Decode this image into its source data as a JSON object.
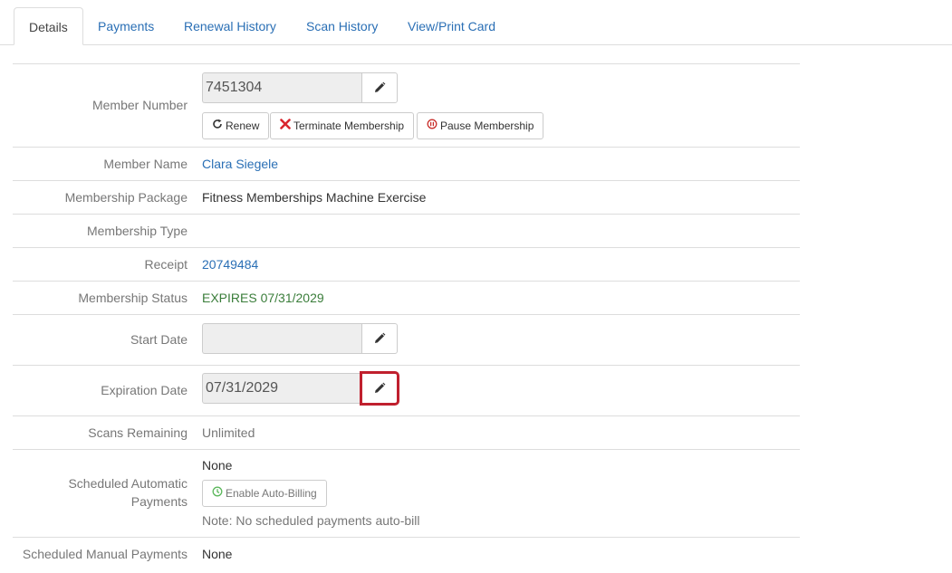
{
  "tabs": [
    {
      "label": "Details",
      "active": true
    },
    {
      "label": "Payments",
      "active": false
    },
    {
      "label": "Renewal History",
      "active": false
    },
    {
      "label": "Scan History",
      "active": false
    },
    {
      "label": "View/Print Card",
      "active": false
    }
  ],
  "member_number": {
    "label": "Member Number",
    "value": "7451304",
    "renew_label": "Renew",
    "terminate_label": "Terminate Membership",
    "pause_label": "Pause Membership"
  },
  "member_name": {
    "label": "Member Name",
    "value": "Clara Siegele"
  },
  "membership_package": {
    "label": "Membership Package",
    "value": "Fitness Memberships Machine Exercise"
  },
  "membership_type": {
    "label": "Membership Type",
    "value": ""
  },
  "receipt": {
    "label": "Receipt",
    "value": "20749484"
  },
  "membership_status": {
    "label": "Membership Status",
    "value": "EXPIRES 07/31/2029"
  },
  "start_date": {
    "label": "Start Date",
    "value": ""
  },
  "expiration_date": {
    "label": "Expiration Date",
    "value": "07/31/2029"
  },
  "scans_remaining": {
    "label": "Scans Remaining",
    "value": "Unlimited"
  },
  "scheduled_automatic_payments": {
    "label_line1": "Scheduled Automatic",
    "label_line2": "Payments",
    "value": "None",
    "enable_label": "Enable Auto-Billing",
    "note": "Note: No scheduled payments auto-bill"
  },
  "scheduled_manual_payments": {
    "label": "Scheduled Manual Payments",
    "value": "None"
  },
  "colors": {
    "link": "#2a6fb5",
    "status_green": "#3a7d3a",
    "highlight_red": "#c0202e",
    "terminate_red": "#d9262e",
    "pause_red": "#c9302c",
    "autobill_green": "#5cb85c"
  },
  "icons": {
    "edit": "pencil-icon",
    "renew": "refresh-icon",
    "terminate": "x-icon",
    "pause": "pause-circle-icon",
    "autobill": "clock-icon"
  }
}
